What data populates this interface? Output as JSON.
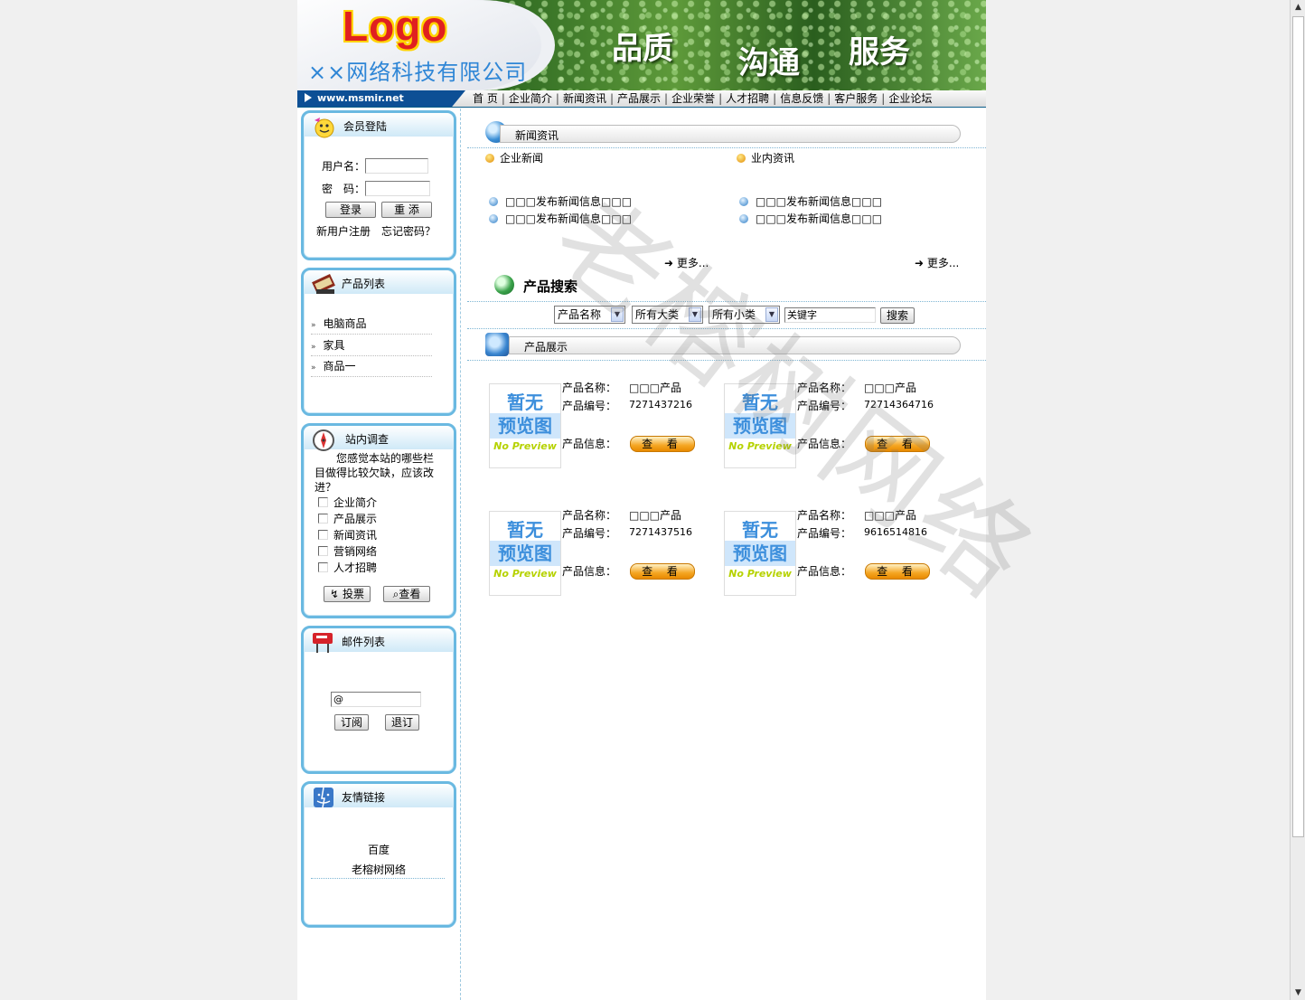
{
  "header": {
    "logo": "Logo",
    "company": "××网络科技有限公司",
    "slogans": [
      "品质",
      "沟通",
      "服务"
    ],
    "url": "www.msmir.net"
  },
  "nav": [
    "首 页",
    "企业简介",
    "新闻资讯",
    "产品展示",
    "企业荣誉",
    "人才招聘",
    "信息反馈",
    "客户服务",
    "企业论坛"
  ],
  "login": {
    "title": "会员登陆",
    "username_label": "用户名：",
    "password_label": "密　码：",
    "login_btn": "登录",
    "reset_btn": "重 添",
    "register_link": "新用户注册",
    "forgot_link": "忘记密码？"
  },
  "products_box": {
    "title": "产品列表",
    "items": [
      "电脑商品",
      "家具",
      "商品一"
    ]
  },
  "survey": {
    "title": "站内调查",
    "question": "您感觉本站的哪些栏目做得比较欠缺，应该改进？",
    "options": [
      "企业简介",
      "产品展示",
      "新闻资讯",
      "营销网络",
      "人才招聘"
    ],
    "vote_btn": "投票",
    "view_btn": "查看"
  },
  "mail": {
    "title": "邮件列表",
    "input_value": "@",
    "subscribe_btn": "订阅",
    "unsubscribe_btn": "退订"
  },
  "links": {
    "title": "友情链接",
    "items": [
      "百度",
      "老榕树网络"
    ]
  },
  "news": {
    "title": "新闻资讯",
    "col1_title": "企业新闻",
    "col2_title": "业内资讯",
    "col1_items": [
      "□□□发布新闻信息□□□",
      "□□□发布新闻信息□□□"
    ],
    "col2_items": [
      "□□□发布新闻信息□□□",
      "□□□发布新闻信息□□□"
    ],
    "more": "更多..."
  },
  "search": {
    "title": "产品搜索",
    "field_select": "产品名称",
    "cat_select": "所有大类",
    "subcat_select": "所有小类",
    "keyword_value": "关键字",
    "btn": "搜索"
  },
  "showcase": {
    "title": "产品展示",
    "name_label": "产品名称：",
    "code_label": "产品编号：",
    "info_label": "产品信息：",
    "view_btn": "查 看",
    "thumb": {
      "line1": "暂无",
      "line2": "预览图",
      "line3": "No Preview"
    },
    "products": [
      {
        "name": "□□□产品",
        "code": "7271437216"
      },
      {
        "name": "□□□产品",
        "code": "72714364716"
      },
      {
        "name": "□□□产品",
        "code": "7271437516"
      },
      {
        "name": "□□□产品",
        "code": "9616514816"
      }
    ]
  },
  "watermark": "老榕树网络",
  "colors": {
    "frame": "#6ab9e1",
    "nav_border": "#0b5e8a",
    "url_badge": "#0d4f95"
  }
}
